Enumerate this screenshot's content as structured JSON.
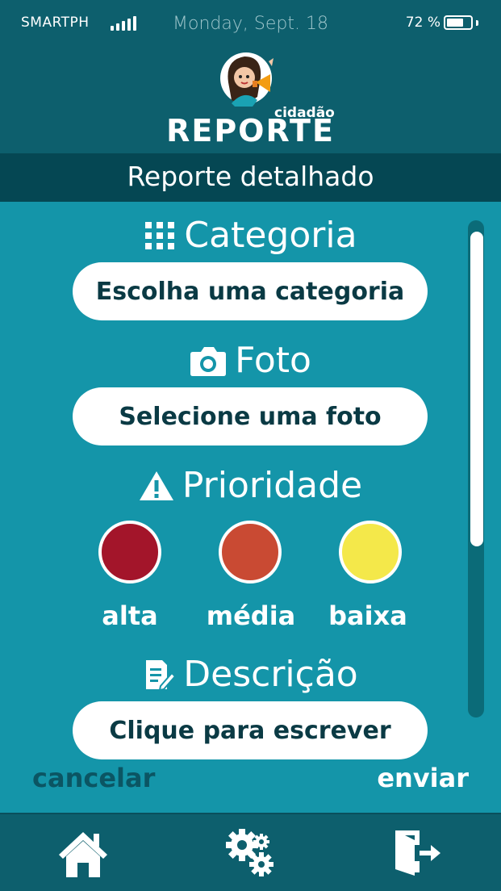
{
  "status_bar": {
    "carrier": "SMARTPH",
    "date": "Monday, Sept. 18",
    "battery": "72 %",
    "battery_level": 0.72
  },
  "app": {
    "logo_small": "cidadão",
    "logo_main": "REPORTE"
  },
  "page_title": "Reporte detalhado",
  "form": {
    "category": {
      "title": "Categoria",
      "icon": "grid-icon",
      "button": "Escolha uma categoria"
    },
    "photo": {
      "title": "Foto",
      "icon": "camera-icon",
      "button": "Selecione uma foto"
    },
    "priority": {
      "title": "Prioridade",
      "icon": "warning-icon",
      "options": [
        {
          "label": "alta",
          "color": "#a3152a"
        },
        {
          "label": "média",
          "color": "#c94a33"
        },
        {
          "label": "baixa",
          "color": "#f4e84a"
        }
      ]
    },
    "description": {
      "title": "Descrição",
      "icon": "document-edit-icon",
      "button": "Clique para escrever"
    }
  },
  "actions": {
    "cancel": "cancelar",
    "send": "enviar"
  },
  "nav": [
    {
      "icon": "home-icon"
    },
    {
      "icon": "gears-icon"
    },
    {
      "icon": "logout-icon"
    }
  ],
  "colors": {
    "background": "#1495a9",
    "header": "#0d5f6d",
    "titlebar": "#054753",
    "cancel_text": "#0b5563"
  }
}
